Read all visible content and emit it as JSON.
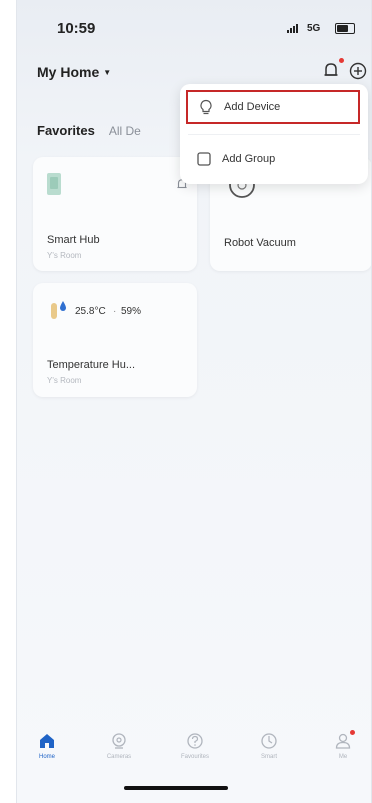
{
  "status_bar": {
    "time": "10:59",
    "network": "5G"
  },
  "header": {
    "home_name": "My Home"
  },
  "tabs": {
    "favorites": "Favorites",
    "all_devices": "All De"
  },
  "devices": [
    {
      "name": "Smart Hub",
      "room": "Y's Room"
    },
    {
      "name": "Robot Vacuum",
      "room": ""
    },
    {
      "name": "Temperature Hu...",
      "room": "Y's Room",
      "temperature": "25.8°C",
      "humidity": "59%"
    }
  ],
  "add_menu": {
    "add_device": "Add Device",
    "add_group": "Add Group"
  },
  "tab_bar": [
    {
      "label": "Home",
      "icon": "home-icon",
      "active": true
    },
    {
      "label": "Cameras",
      "icon": "camera-icon"
    },
    {
      "label": "Favourites",
      "icon": "favourites-icon"
    },
    {
      "label": "Smart",
      "icon": "smart-icon"
    },
    {
      "label": "Me",
      "icon": "me-icon"
    }
  ],
  "colors": {
    "accent": "#1f63c6",
    "highlight": "#c62828",
    "badge": "#e53935"
  }
}
